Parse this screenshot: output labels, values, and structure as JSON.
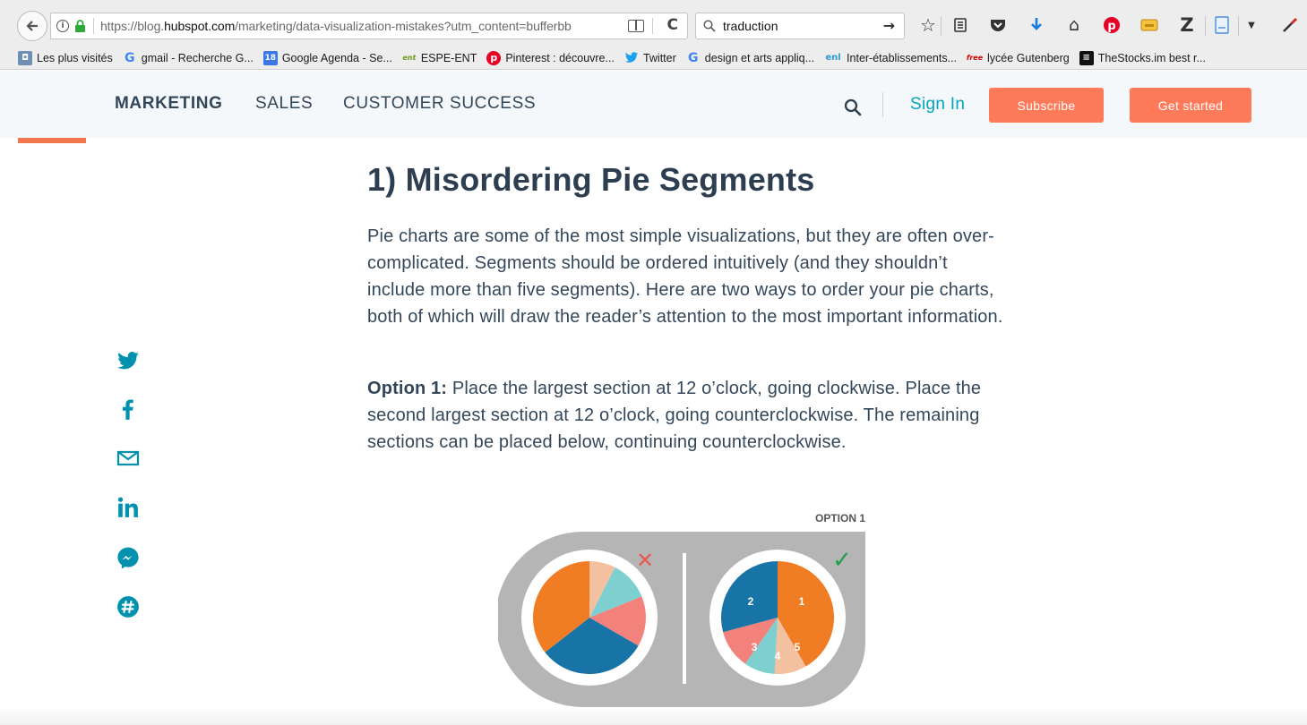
{
  "browser": {
    "url_prefix": "https://blog.",
    "url_domain": "hubspot.com",
    "url_path": "/marketing/data-visualization-mistakes?utm_content=bufferbb",
    "search_value": "traduction",
    "bookmarks": [
      {
        "label": "Les plus visités",
        "icon": "folder-icon"
      },
      {
        "label": "gmail - Recherche G...",
        "icon": "google-icon"
      },
      {
        "label": "Google Agenda - Se...",
        "icon": "calendar-icon",
        "badge": "18"
      },
      {
        "label": "ESPE-ENT",
        "icon": "ent-icon",
        "badge": "ent"
      },
      {
        "label": "Pinterest : découvre...",
        "icon": "pinterest-icon"
      },
      {
        "label": "Twitter",
        "icon": "twitter-icon"
      },
      {
        "label": "design et arts appliq...",
        "icon": "google-icon"
      },
      {
        "label": "Inter-établissements...",
        "icon": "enl-icon",
        "badge": "enl"
      },
      {
        "label": "lycée Gutenberg",
        "icon": "free-icon",
        "badge": "free"
      },
      {
        "label": "TheStocks.im best r...",
        "icon": "thestocks-icon"
      }
    ]
  },
  "sitenav": {
    "links": [
      "MARKETING",
      "SALES",
      "CUSTOMER SUCCESS"
    ],
    "signin": "Sign In",
    "subscribe": "Subscribe",
    "get_started": "Get started"
  },
  "article": {
    "title": "1) Misordering Pie Segments",
    "para1": "Pie charts are some of the most simple visualizations, but they are often over-complicated. Segments should be ordered intuitively (and they shouldn’t include more than five segments). Here are two ways to order your pie charts, both of which will draw the reader’s attention to the most important information.",
    "option_label": "Option 1:",
    "option_text": " Place the largest section at 12 o’clock, going clockwise. Place the second largest section at 12 o’clock, going counterclockwise. The remaining sections can be placed below, continuing counterclockwise."
  },
  "figure": {
    "caption": "OPTION 1",
    "wrong_mark": "✕",
    "right_mark": "✓",
    "segment_labels": [
      "1",
      "2",
      "3",
      "4",
      "5"
    ],
    "colors": {
      "orange": "#f07d23",
      "blue": "#1874a6",
      "salmon": "#f2827b",
      "teal": "#7dcfd0",
      "peach": "#f3c1a0",
      "panel": "#b5b5b6",
      "wrong": "#ea5a4e",
      "right": "#1f9e4b"
    }
  },
  "social": [
    "twitter-icon",
    "facebook-icon",
    "email-icon",
    "linkedin-icon",
    "messenger-icon",
    "slack-icon"
  ],
  "colors": {
    "brand_orange": "#ff7a59",
    "teal_link": "#00a4bd",
    "text": "#33475b"
  }
}
